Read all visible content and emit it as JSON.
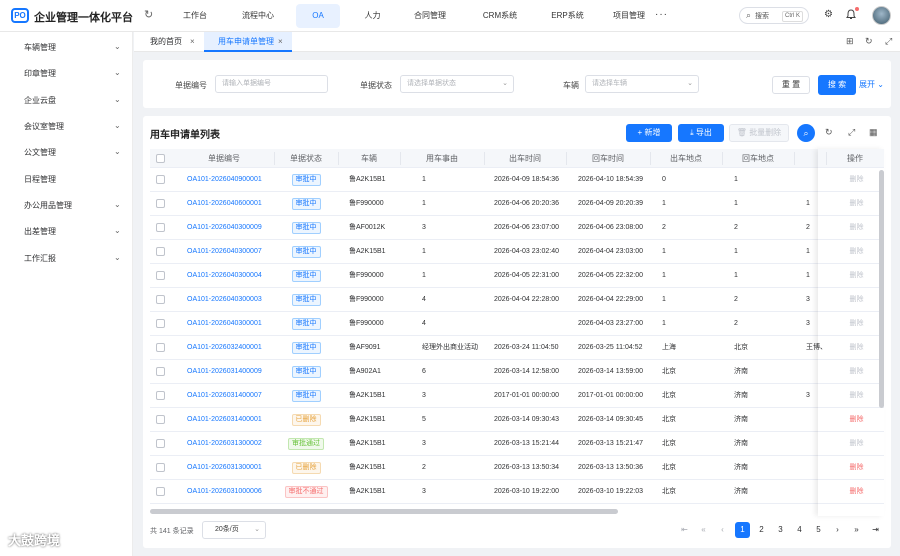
{
  "header": {
    "logo_text": "PO",
    "app_title": "企业管理一体化平台",
    "nav": [
      {
        "label": "工作台",
        "active": false
      },
      {
        "label": "流程中心",
        "active": false
      },
      {
        "label": "OA",
        "active": true
      },
      {
        "label": "人力",
        "active": false
      },
      {
        "label": "合同管理",
        "active": false
      },
      {
        "label": "CRM系统",
        "active": false
      },
      {
        "label": "ERP系统",
        "active": false
      },
      {
        "label": "项目管理",
        "active": false
      }
    ],
    "more_label": "···",
    "search_placeholder": "搜索",
    "search_shortcut": "Ctrl K"
  },
  "sidebar": {
    "items": [
      {
        "label": "车辆管理",
        "has_children": true
      },
      {
        "label": "印章管理",
        "has_children": true
      },
      {
        "label": "企业云盘",
        "has_children": true
      },
      {
        "label": "会议室管理",
        "has_children": true
      },
      {
        "label": "公文管理",
        "has_children": true
      },
      {
        "label": "日程管理",
        "has_children": false
      },
      {
        "label": "办公用品管理",
        "has_children": true
      },
      {
        "label": "出差管理",
        "has_children": true
      },
      {
        "label": "工作汇报",
        "has_children": true
      }
    ]
  },
  "tabs": [
    {
      "label": "我的首页",
      "active": false
    },
    {
      "label": "用车申请单管理",
      "active": true
    }
  ],
  "filters": {
    "doc_no_label": "单据编号",
    "doc_no_placeholder": "请输入单据编号",
    "status_label": "单据状态",
    "status_placeholder": "请选择单据状态",
    "vehicle_label": "车辆",
    "vehicle_placeholder": "请选择车辆",
    "reset_label": "重 置",
    "search_label": "搜 索",
    "expand_label": "展开"
  },
  "list": {
    "title": "用车申请单列表",
    "add_label": "+ 新增",
    "export_label": "导出",
    "batch_delete_label": "批量删除",
    "columns": [
      "单据编号",
      "单据状态",
      "车辆",
      "用车事由",
      "出车时间",
      "回车时间",
      "出车地点",
      "回车地点",
      "",
      "操作"
    ],
    "rows": [
      {
        "no": "OA101-2026040900001",
        "status": "审批中",
        "status_type": "pending",
        "vehicle": "鲁A2K15B1",
        "reason": "1",
        "out_time": "2026-04-09 18:54:36",
        "back_time": "2026-04-10 18:54:39",
        "out_place": "0",
        "back_place": "1",
        "extra": "",
        "op": "删除",
        "op_type": "disabled"
      },
      {
        "no": "OA101-2026040600001",
        "status": "审批中",
        "status_type": "pending",
        "vehicle": "鲁F990000",
        "reason": "1",
        "out_time": "2026-04-06 20:20:36",
        "back_time": "2026-04-09 20:20:39",
        "out_place": "1",
        "back_place": "1",
        "extra": "1",
        "op": "删除",
        "op_type": "disabled"
      },
      {
        "no": "OA101-2026040300009",
        "status": "审批中",
        "status_type": "pending",
        "vehicle": "鲁AF0012K",
        "reason": "3",
        "out_time": "2026-04-06 23:07:00",
        "back_time": "2026-04-06 23:08:00",
        "out_place": "2",
        "back_place": "2",
        "extra": "2",
        "op": "删除",
        "op_type": "disabled"
      },
      {
        "no": "OA101-2026040300007",
        "status": "审批中",
        "status_type": "pending",
        "vehicle": "鲁A2K15B1",
        "reason": "1",
        "out_time": "2026-04-03 23:02:40",
        "back_time": "2026-04-04 23:03:00",
        "out_place": "1",
        "back_place": "1",
        "extra": "1",
        "op": "删除",
        "op_type": "disabled"
      },
      {
        "no": "OA101-2026040300004",
        "status": "审批中",
        "status_type": "pending",
        "vehicle": "鲁F990000",
        "reason": "1",
        "out_time": "2026-04-05 22:31:00",
        "back_time": "2026-04-05 22:32:00",
        "out_place": "1",
        "back_place": "1",
        "extra": "1",
        "op": "删除",
        "op_type": "disabled"
      },
      {
        "no": "OA101-2026040300003",
        "status": "审批中",
        "status_type": "pending",
        "vehicle": "鲁F990000",
        "reason": "4",
        "out_time": "2026-04-04 22:28:00",
        "back_time": "2026-04-04 22:29:00",
        "out_place": "1",
        "back_place": "2",
        "extra": "3",
        "op": "删除",
        "op_type": "disabled"
      },
      {
        "no": "OA101-2026040300001",
        "status": "审批中",
        "status_type": "pending",
        "vehicle": "鲁F990000",
        "reason": "4",
        "out_time": "",
        "back_time": "2026-04-03 23:27:00",
        "out_place": "1",
        "back_place": "2",
        "extra": "3",
        "op": "删除",
        "op_type": "disabled"
      },
      {
        "no": "OA101-2026032400001",
        "status": "审批中",
        "status_type": "pending",
        "vehicle": "鲁AF9091",
        "reason": "经理外出商业活动",
        "out_time": "2026-03-24 11:04:50",
        "back_time": "2026-03-25 11:04:52",
        "out_place": "上海",
        "back_place": "北京",
        "extra": "王博、",
        "op": "删除",
        "op_type": "disabled"
      },
      {
        "no": "OA101-2026031400009",
        "status": "审批中",
        "status_type": "pending",
        "vehicle": "鲁A902A1",
        "reason": "6",
        "out_time": "2026-03-14 12:58:00",
        "back_time": "2026-03-14 13:59:00",
        "out_place": "北京",
        "back_place": "济南",
        "extra": "",
        "op": "删除",
        "op_type": "disabled"
      },
      {
        "no": "OA101-2026031400007",
        "status": "审批中",
        "status_type": "pending",
        "vehicle": "鲁A2K15B1",
        "reason": "3",
        "out_time": "2017-01-01 00:00:00",
        "back_time": "2017-01-01 00:00:00",
        "out_place": "北京",
        "back_place": "济南",
        "extra": "3",
        "op": "删除",
        "op_type": "disabled"
      },
      {
        "no": "OA101-2026031400001",
        "status": "已删除",
        "status_type": "deleted",
        "vehicle": "鲁A2K15B1",
        "reason": "5",
        "out_time": "2026-03-14 09:30:43",
        "back_time": "2026-03-14 09:30:45",
        "out_place": "北京",
        "back_place": "济南",
        "extra": "",
        "op": "删除",
        "op_type": "danger"
      },
      {
        "no": "OA101-2026031300002",
        "status": "审批通过",
        "status_type": "approved",
        "vehicle": "鲁A2K15B1",
        "reason": "3",
        "out_time": "2026-03-13 15:21:44",
        "back_time": "2026-03-13 15:21:47",
        "out_place": "北京",
        "back_place": "济南",
        "extra": "",
        "op": "删除",
        "op_type": "disabled"
      },
      {
        "no": "OA101-2026031300001",
        "status": "已删除",
        "status_type": "deleted",
        "vehicle": "鲁A2K15B1",
        "reason": "2",
        "out_time": "2026-03-13 13:50:34",
        "back_time": "2026-03-13 13:50:36",
        "out_place": "北京",
        "back_place": "济南",
        "extra": "",
        "op": "删除",
        "op_type": "danger"
      },
      {
        "no": "OA101-2026031000006",
        "status": "审批不通过",
        "status_type": "rejected",
        "vehicle": "鲁A2K15B1",
        "reason": "3",
        "out_time": "2026-03-10 19:22:00",
        "back_time": "2026-03-10 19:22:03",
        "out_place": "北京",
        "back_place": "济南",
        "extra": "",
        "op": "删除",
        "op_type": "danger"
      }
    ]
  },
  "pagination": {
    "total_text": "共 141 条记录",
    "page_size": "20条/页",
    "pages": [
      "1",
      "2",
      "3",
      "4",
      "5"
    ],
    "current": 1
  },
  "watermark": "大鼓跨境"
}
